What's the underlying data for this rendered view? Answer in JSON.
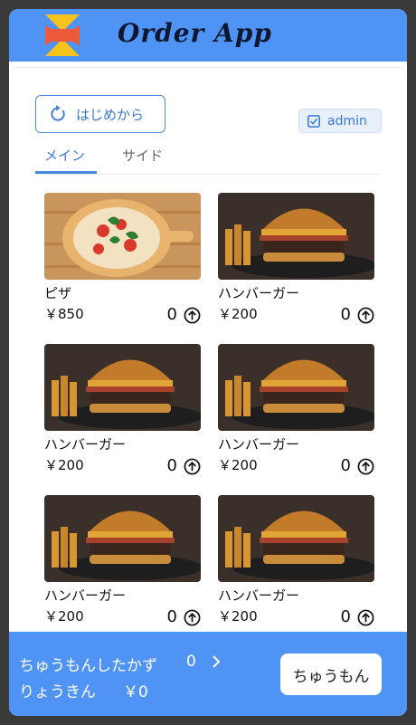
{
  "header": {
    "app_title": "Order App"
  },
  "toolbar": {
    "restart_label": "はじめから",
    "admin_label": "admin"
  },
  "tabs": [
    {
      "label": "メイン"
    },
    {
      "label": "サイド"
    }
  ],
  "menu": [
    {
      "name": "ピザ",
      "price": "￥850",
      "qty": "0",
      "image": "pizza"
    },
    {
      "name": "ハンバーガー",
      "price": "￥200",
      "qty": "0",
      "image": "burger"
    },
    {
      "name": "ハンバーガー",
      "price": "￥200",
      "qty": "0",
      "image": "burger"
    },
    {
      "name": "ハンバーガー",
      "price": "￥200",
      "qty": "0",
      "image": "burger"
    },
    {
      "name": "ハンバーガー",
      "price": "￥200",
      "qty": "0",
      "image": "burger"
    },
    {
      "name": "ハンバーガー",
      "price": "￥200",
      "qty": "0",
      "image": "burger"
    }
  ],
  "footer": {
    "count_label": "ちゅうもんしたかず",
    "count_value": "0",
    "total_label": "りょうきん",
    "total_value": "￥0",
    "order_label": "ちゅうもん"
  },
  "colors": {
    "accent": "#4f93f5",
    "link": "#3a78d8"
  },
  "icons": {
    "restart": "refresh-icon",
    "admin": "checkbox-icon",
    "add": "arrow-up-circle-icon",
    "more": "chevron-right-icon"
  }
}
